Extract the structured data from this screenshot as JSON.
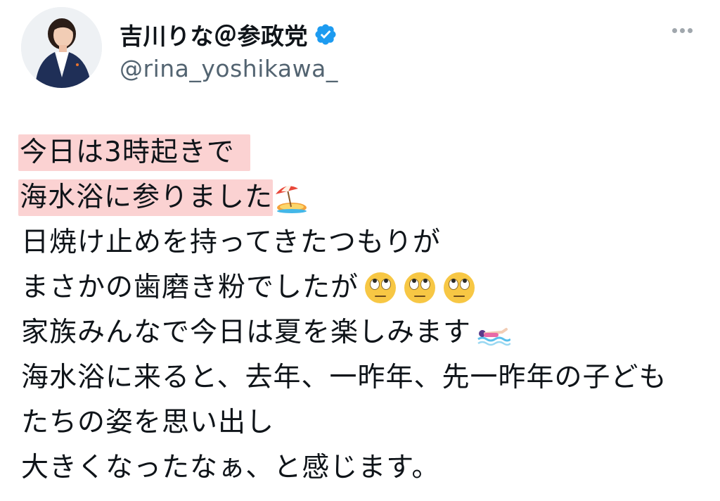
{
  "user": {
    "display_name": "吉川りな＠参政党",
    "handle": "@rina_yoshikawa_",
    "avatar_icon": "avatar-photo",
    "verified_icon": "verified-badge-icon",
    "verified_color": "#1d9bf0"
  },
  "more_icon": "more-options-icon",
  "tweet": {
    "lines": [
      "今日は3時起きで",
      "海水浴に参りました",
      "日焼け止めを持ってきたつもりが",
      "まさかの歯磨き粉でしたが",
      "家族みんなで今日は夏を楽しみます",
      "海水浴に来ると、去年、一昨年、先一昨年の子ども",
      "たちの姿を思い出し",
      "大きくなったなぁ、と感じます。"
    ],
    "highlight_color": "#fbd2d2",
    "emojis": {
      "line2": "beach-umbrella-island-emoji",
      "line4": [
        "eye-roll-face-emoji",
        "eye-roll-face-emoji",
        "eye-roll-face-emoji"
      ],
      "line5": "swimmer-emoji"
    }
  }
}
